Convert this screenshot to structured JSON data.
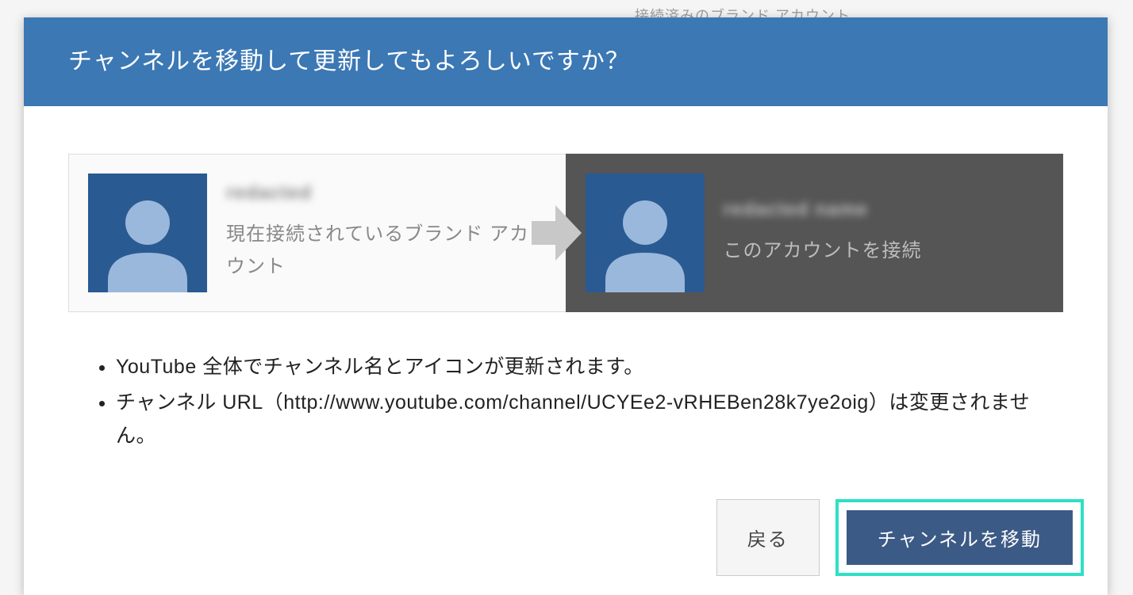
{
  "background": {
    "partial_text": "接続済みのブランド アカウント"
  },
  "dialog": {
    "title": "チャンネルを移動して更新してもよろしいですか？",
    "source_account": {
      "name_placeholder": "redacted",
      "description": "現在接続されているブランド アカウント"
    },
    "target_account": {
      "name_placeholder": "redacted name",
      "description": "このアカウントを接続"
    },
    "info_items": {
      "item1": "YouTube 全体でチャンネル名とアイコンが更新されます。",
      "item2_prefix": "チャンネル URL（",
      "item2_url": "http://www.youtube.com/channel/UCYEe2-vRHEBen28k7ye2oig",
      "item2_suffix": "）は変更されません。"
    },
    "buttons": {
      "back": "戻る",
      "move": "チャンネルを移動"
    }
  }
}
